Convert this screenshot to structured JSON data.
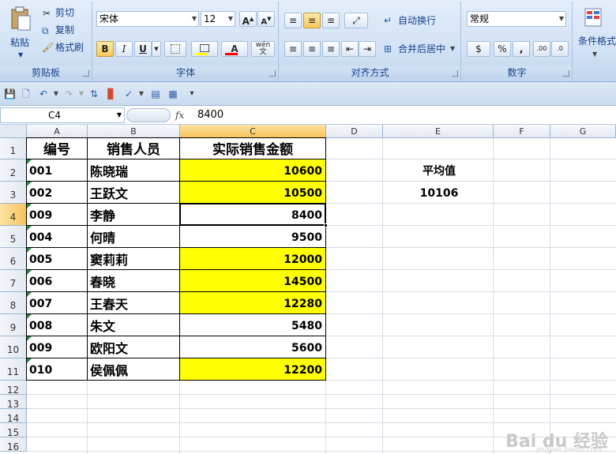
{
  "ribbon": {
    "clipboard": {
      "paste": "粘贴",
      "cut": "剪切",
      "copy": "复制",
      "format_painter": "格式刷",
      "label": "剪贴板"
    },
    "font": {
      "name": "宋体",
      "size": "12",
      "bold": "B",
      "italic": "I",
      "underline": "U",
      "label": "字体",
      "phonetic": "wén"
    },
    "alignment": {
      "wrap": "自动换行",
      "merge": "合并后居中",
      "label": "对齐方式"
    },
    "number": {
      "format": "常规",
      "label": "数字",
      "percent": "%",
      "comma": ","
    },
    "styles": {
      "conditional": "条件格式"
    }
  },
  "formula_bar": {
    "name_box": "C4",
    "fx": "fx",
    "value": "8400"
  },
  "columns": [
    "A",
    "B",
    "C",
    "D",
    "E",
    "F",
    "G"
  ],
  "rows": [
    "1",
    "2",
    "3",
    "4",
    "5",
    "6",
    "7",
    "8",
    "9",
    "10",
    "11",
    "12",
    "13",
    "14",
    "15",
    "16"
  ],
  "table": {
    "headers": [
      "编号",
      "销售人员",
      "实际销售金额"
    ],
    "rows": [
      {
        "id": "001",
        "name": "陈晓瑞",
        "amount": "10600"
      },
      {
        "id": "002",
        "name": "王跃文",
        "amount": "10500"
      },
      {
        "id": "009",
        "name": "李静",
        "amount": "8400"
      },
      {
        "id": "004",
        "name": "何晴",
        "amount": "9500"
      },
      {
        "id": "005",
        "name": "窦莉莉",
        "amount": "12000"
      },
      {
        "id": "006",
        "name": "春晓",
        "amount": "14500"
      },
      {
        "id": "007",
        "name": "王春天",
        "amount": "12280"
      },
      {
        "id": "008",
        "name": "朱文",
        "amount": "5480"
      },
      {
        "id": "009",
        "name": "欧阳文",
        "amount": "5600"
      },
      {
        "id": "010",
        "name": "侯佩佩",
        "amount": "12200"
      }
    ]
  },
  "side": {
    "avg_label": "平均值",
    "avg_value": "10106"
  },
  "watermark": {
    "brand": "Bai du 经验",
    "url": "jingyan.baidu.com"
  },
  "colors": {
    "highlight": "#ffff00",
    "selection_header": "#f7c35c"
  }
}
